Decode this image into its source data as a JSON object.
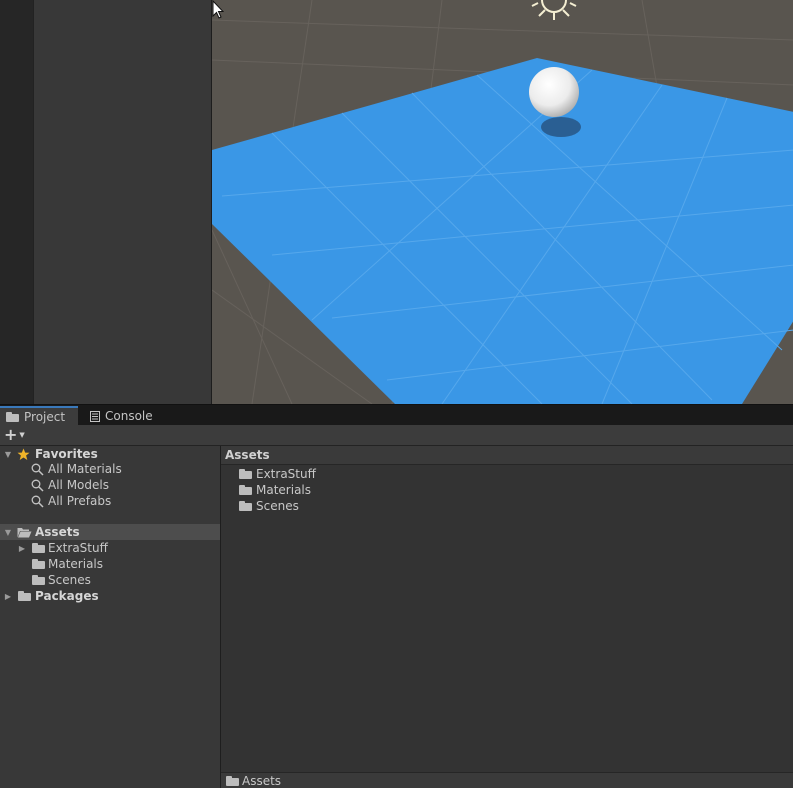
{
  "tabs": [
    {
      "label": "Project",
      "active": true,
      "icon": "folder-icon"
    },
    {
      "label": "Console",
      "active": false,
      "icon": "console-icon"
    }
  ],
  "toolbar": {
    "add_label": "+"
  },
  "favorites": {
    "label": "Favorites",
    "items": [
      "All Materials",
      "All Models",
      "All Prefabs"
    ]
  },
  "tree": {
    "assets_label": "Assets",
    "children": [
      "ExtraStuff",
      "Materials",
      "Scenes"
    ],
    "packages_label": "Packages"
  },
  "content": {
    "header": "Assets",
    "items": [
      "ExtraStuff",
      "Materials",
      "Scenes"
    ],
    "path": "Assets"
  },
  "colors": {
    "plane": "#3a97e6",
    "ground": "#59554f",
    "selection": "#4d4d4d",
    "tab_accent": "#3a79bb"
  }
}
